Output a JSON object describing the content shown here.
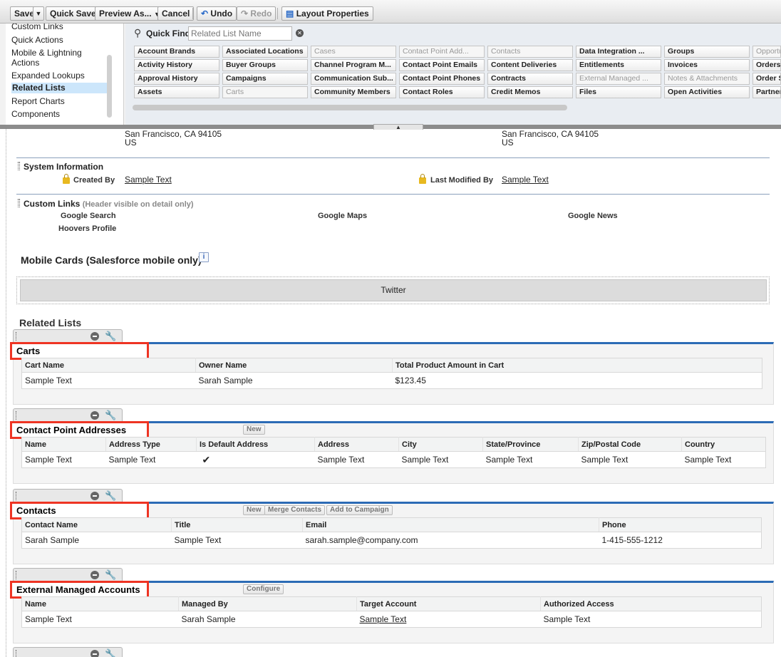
{
  "toolbar": {
    "save": "Save",
    "quick_save": "Quick Save",
    "preview_as": "Preview As...",
    "cancel": "Cancel",
    "undo": "Undo",
    "redo": "Redo",
    "layout_properties": "Layout Properties"
  },
  "palette": {
    "categories": [
      "Custom Links",
      "Quick Actions",
      "Mobile & Lightning",
      "Actions",
      "Expanded Lookups",
      "Related Lists",
      "Report Charts",
      "Components"
    ],
    "selected_category": "Related Lists",
    "quick_find_label": "Quick Find",
    "quick_find_placeholder": "Related List Name",
    "fields": [
      [
        "Account Brands",
        "Activity History",
        "Approval History",
        "Assets"
      ],
      [
        "Associated Locations",
        "Buyer Groups",
        "Campaigns",
        "Carts"
      ],
      [
        "Cases",
        "Channel Program M...",
        "Communication Sub...",
        "Community Members"
      ],
      [
        "Contact Point Add...",
        "Contact Point Emails",
        "Contact Point Phones",
        "Contact Roles"
      ],
      [
        "Contacts",
        "Content Deliveries",
        "Contracts",
        "Credit Memos"
      ],
      [
        "Data Integration ...",
        "Entitlements",
        "External Managed ...",
        "Files"
      ],
      [
        "Groups",
        "Invoices",
        "Notes & Attachments",
        "Open Activities"
      ],
      [
        "Opportu",
        "Orders",
        "Order S",
        "Partner"
      ]
    ],
    "used_fields": [
      "Cases",
      "Contact Point Add...",
      "Contacts",
      "Carts",
      "External Managed ...",
      "Notes & Attachments",
      "Opportu"
    ]
  },
  "address": {
    "left_line1": "San Francisco, CA 94105",
    "left_line2": "US",
    "right_line1": "San Francisco, CA 94105",
    "right_line2": "US"
  },
  "system_info": {
    "title": "System Information",
    "created_by_label": "Created By",
    "created_by_value": "Sample Text",
    "last_modified_label": "Last Modified By",
    "last_modified_value": "Sample Text"
  },
  "custom_links": {
    "title": "Custom Links",
    "hint": "(Header visible on detail only)",
    "links": [
      "Google Search",
      "Google Maps",
      "Google News",
      "Hoovers Profile"
    ]
  },
  "mobile_cards": {
    "title": "Mobile Cards (Salesforce mobile only)",
    "info": "i",
    "card": "Twitter"
  },
  "related_lists_heading": "Related Lists",
  "related_lists": [
    {
      "title": "Carts",
      "buttons": [],
      "columns": [
        "Cart Name",
        "Owner Name",
        "Total Product Amount in Cart"
      ],
      "row": [
        "Sample Text",
        "Sarah Sample",
        "$123.45"
      ]
    },
    {
      "title": "Contact Point Addresses",
      "buttons": [
        "New"
      ],
      "columns": [
        "Name",
        "Address Type",
        "Is Default Address",
        "Address",
        "City",
        "State/Province",
        "Zip/Postal Code",
        "Country"
      ],
      "row": [
        "Sample Text",
        "Sample Text",
        "✔",
        "Sample Text",
        "Sample Text",
        "Sample Text",
        "Sample Text",
        "Sample Text"
      ]
    },
    {
      "title": "Contacts",
      "buttons": [
        "New",
        "Merge Contacts",
        "Add to Campaign"
      ],
      "columns": [
        "Contact Name",
        "Title",
        "Email",
        "Phone"
      ],
      "row": [
        "Sarah Sample",
        "Sample Text",
        "sarah.sample@company.com",
        "1-415-555-1212"
      ]
    },
    {
      "title": "External Managed Accounts",
      "buttons": [
        "Configure"
      ],
      "columns": [
        "Name",
        "Managed By",
        "Target Account",
        "Authorized Access"
      ],
      "row": [
        "Sample Text",
        "Sarah Sample",
        "Sample Text",
        "Sample Text"
      ]
    }
  ]
}
